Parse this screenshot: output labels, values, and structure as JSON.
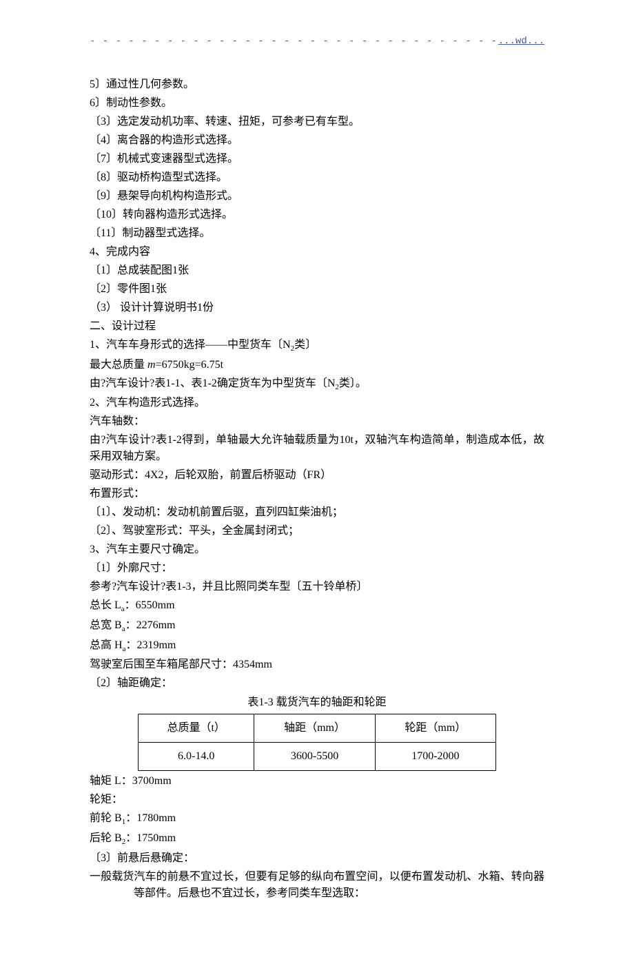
{
  "header": {
    "text": "...wd..."
  },
  "lines": {
    "a5": "5〕通过性几何参数。",
    "a6": "6〕制动性参数。",
    "b3": "〔3〕选定发动机功率、转速、扭矩，可参考已有车型。",
    "b4": "〔4〕离合器的构造形式选择。",
    "b7": "〔7〕机械式变速器型式选择。",
    "b8": "〔8〕驱动桥构造型式选择。",
    "b9": "〔9〕悬架导向机构构造形式。",
    "b10": "〔10〕转向器构造形式选择。",
    "b11": "〔11〕制动器型式选择。",
    "c4": "4、完成内容",
    "c4_1": "〔1〕总成装配图1张",
    "c4_2": "〔2〕零件图1张",
    "c4_3": "（3）  设计计算说明书1份",
    "h2": "二、设计过程",
    "s1": "1、汽车车身形式的选择——中型货车〔N",
    "s1_suffix": "类〕",
    "s1_sub": "2",
    "s1_a_pre": "最大总质量 ",
    "s1_a_m": "m",
    "s1_a_val": "=6750kg=6.75t",
    "s1_b": "由?汽车设计?表1-1、表1-2确定货车为中型货车〔N",
    "s1_b_suffix": "类〕。",
    "s1_b_sub": "2",
    "s2": "2、汽车构造形式选择。",
    "s2_axle": "汽车轴数：",
    "s2_axle_txt": "由?汽车设计?表1-2得到，单轴最大允许轴载质量为10t，双轴汽车构造简单，制造成本低，故采用双轴方案。",
    "s2_drive": "驱动形式：4X2，后轮双胎，前置后桥驱动（FR）",
    "s2_layout": "布置形式：",
    "s2_layout_1": "〔1〕、发动机：发动机前置后驱，直列四缸柴油机；",
    "s2_layout_2": "〔2〕、驾驶室形式：平头，全金属封闭式；",
    "s3": "3、汽车主要尺寸确定。",
    "s3_1": "〔1〕外廓尺寸：",
    "s3_1_ref": "参考?汽车设计?表1-3，并且比照同类车型〔五十铃单桥〕",
    "s3_1_la_pre": "总长 L",
    "s3_1_la_sub": "a",
    "s3_1_la_val": "：6550mm",
    "s3_1_ba_pre": "总宽 B",
    "s3_1_ba_sub": "a",
    "s3_1_ba_val": "：2276mm",
    "s3_1_ha_pre": "总高 H",
    "s3_1_ha_sub": "a",
    "s3_1_ha_val": "：2319mm",
    "s3_1_cab": "驾驶室后围至车箱尾部尺寸：4354mm",
    "s3_2": "〔2〕轴距确定：",
    "table_caption": "表1-3 载货汽车的轴距和轮距",
    "table": {
      "h1": "总质量（t）",
      "h2": "轴距（mm）",
      "h3": "轮距（mm）",
      "r1c1": "6.0-14.0",
      "r1c2": "3600-5500",
      "r1c3": "1700-2000"
    },
    "s3_2_l": "轴矩 L：3700mm",
    "s3_2_wheel": "轮矩：",
    "s3_2_b1_pre": "前轮 B",
    "s3_2_b1_sub": "1",
    "s3_2_b1_val": "：1780mm",
    "s3_2_b2_pre": "后轮 B",
    "s3_2_b2_sub": "2",
    "s3_2_b2_val": "：1750mm",
    "s3_3": "〔3〕前悬后悬确定：",
    "s3_3_txt": "一般载货汽车的前悬不宜过长，但要有足够的纵向布置空间，以便布置发动机、水箱、转向器等部件。后悬也不宜过长，参考同类车型选取："
  }
}
